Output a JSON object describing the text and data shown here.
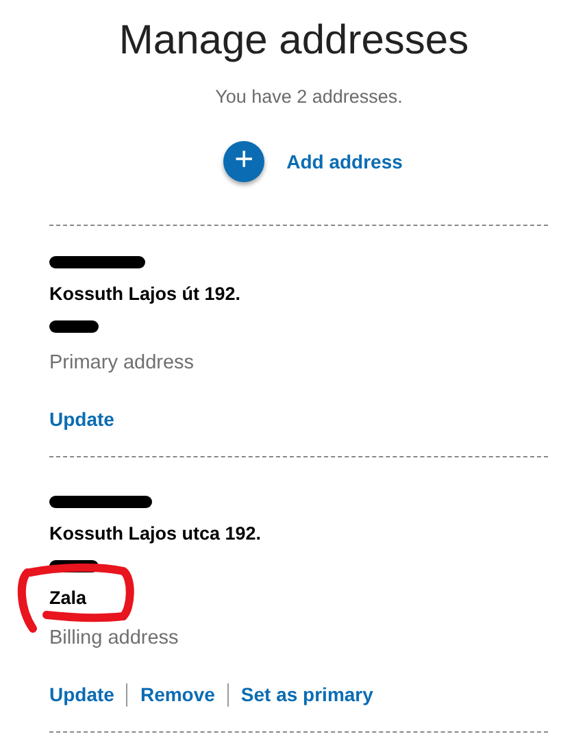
{
  "title": "Manage addresses",
  "subtitle": "You have 2 addresses.",
  "add_button": {
    "icon": "+",
    "label": "Add address"
  },
  "addresses": [
    {
      "street": "Kossuth Lajos út 192.",
      "type_label": "Primary address",
      "actions": [
        "Update"
      ]
    },
    {
      "street": "Kossuth Lajos utca 192.",
      "region": "Zala",
      "type_label": "Billing address",
      "annotated": true,
      "actions": [
        "Update",
        "Remove",
        "Set as primary"
      ]
    }
  ]
}
